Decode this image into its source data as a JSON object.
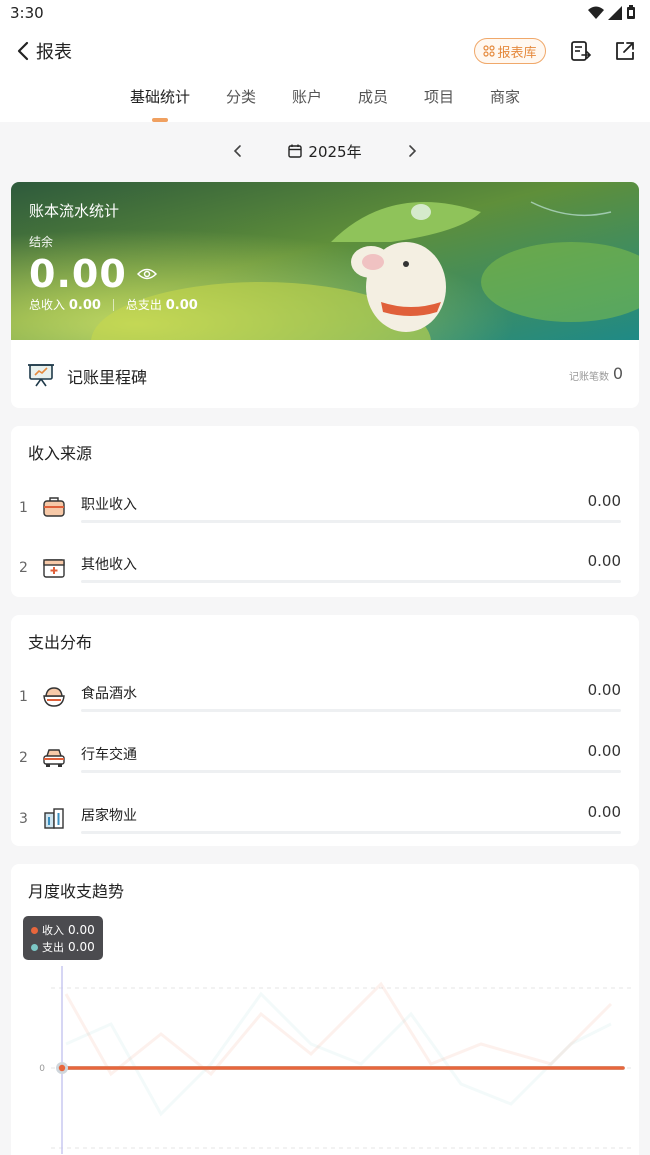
{
  "status_bar": {
    "time": "3:30"
  },
  "header": {
    "back_title": "报表",
    "report_lib_label": "报表库",
    "tabs": [
      "基础统计",
      "分类",
      "账户",
      "成员",
      "项目",
      "商家"
    ]
  },
  "year_selector": {
    "year": "2025年"
  },
  "banner": {
    "title": "账本流水统计",
    "balance_label": "结余",
    "balance": "0.00",
    "income_label": "总收入",
    "income": "0.00",
    "expense_label": "总支出",
    "expense": "0.00"
  },
  "milestone": {
    "title": "记账里程碑",
    "count_label": "记账笔数",
    "count": "0"
  },
  "income_sources": {
    "title": "收入来源",
    "items": [
      {
        "rank": "1",
        "icon": "briefcase-icon",
        "label": "职业收入",
        "amount": "0.00"
      },
      {
        "rank": "2",
        "icon": "gift-box-icon",
        "label": "其他收入",
        "amount": "0.00"
      }
    ]
  },
  "expense_distribution": {
    "title": "支出分布",
    "items": [
      {
        "rank": "1",
        "icon": "food-bowl-icon",
        "label": "食品酒水",
        "amount": "0.00"
      },
      {
        "rank": "2",
        "icon": "car-icon",
        "label": "行车交通",
        "amount": "0.00"
      },
      {
        "rank": "3",
        "icon": "building-icon",
        "label": "居家物业",
        "amount": "0.00"
      }
    ]
  },
  "monthly_trend": {
    "title": "月度收支趋势",
    "tooltip": {
      "income_label": "收入",
      "income": "0.00",
      "expense_label": "支出",
      "expense": "0.00"
    },
    "y_tick": "0"
  },
  "colors": {
    "accent": "#e58a3e",
    "income_series": "#e8663c",
    "expense_series": "#7cc7c6",
    "card_bg": "#ffffff",
    "page_bg": "#f6f6f7"
  },
  "chart_data": {
    "type": "line",
    "title": "月度收支趋势",
    "series": [
      {
        "name": "收入",
        "values": [
          0,
          0,
          0,
          0,
          0,
          0,
          0,
          0,
          0,
          0,
          0,
          0
        ]
      },
      {
        "name": "支出",
        "values": [
          0,
          0,
          0,
          0,
          0,
          0,
          0,
          0,
          0,
          0,
          0,
          0
        ]
      }
    ],
    "y_ticks": [
      "0"
    ],
    "grid": true
  }
}
